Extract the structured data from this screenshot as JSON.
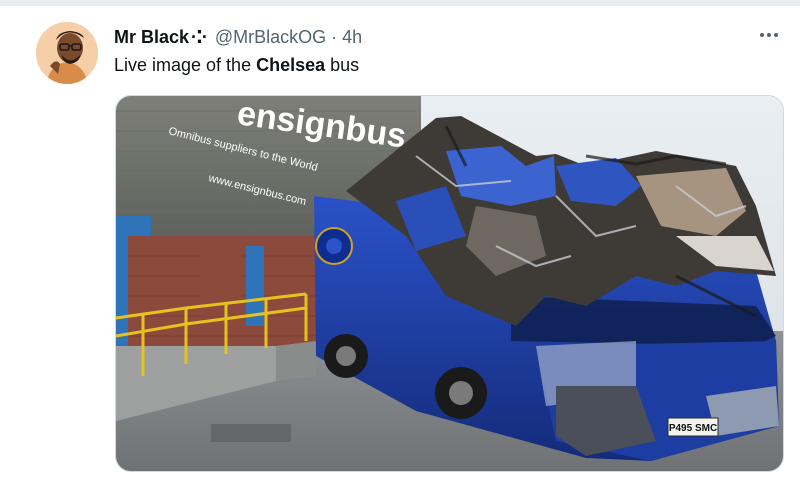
{
  "tweet": {
    "author": {
      "display_name": "Mr Black",
      "name_decoration": "·⁚·",
      "handle": "@MrBlackOG",
      "separator": "·",
      "time": "4h",
      "avatar_icon": "avatar-image"
    },
    "text": {
      "before": "Live image of the ",
      "bold": "Chelsea",
      "after": " bus"
    },
    "more_icon": "more-dots-icon",
    "media": {
      "alt_icon": "photo",
      "building_sign": {
        "brand": "ensignbus",
        "tagline": "Omnibus suppliers to the World",
        "website": "www.ensignbus.com"
      },
      "number_plate": "P495 SMC"
    }
  },
  "colors": {
    "text_primary": "#0f1419",
    "text_secondary": "#536471",
    "border": "#cfd9de",
    "bus_blue": "#1e3fa8"
  }
}
